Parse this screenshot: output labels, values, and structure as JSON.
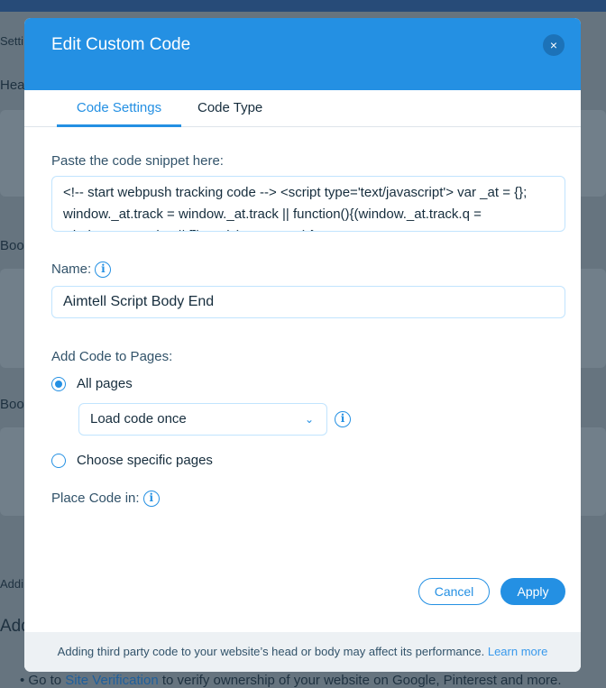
{
  "background": {
    "texts": [
      "Setti",
      "Hea",
      "Boo",
      "Boo",
      "Addi",
      "Add"
    ],
    "bullet_prefix": "Go to ",
    "bullet_link": "Site Verification",
    "bullet_suffix": " to verify ownership of your website on Google, Pinterest and more."
  },
  "modal": {
    "title": "Edit Custom Code",
    "close_icon": "×",
    "tabs": [
      {
        "label": "Code Settings",
        "active": true
      },
      {
        "label": "Code Type",
        "active": false
      }
    ],
    "code_label": "Paste the code snippet here:",
    "code_value": "<!-- start webpush tracking code --> <script type='text/javascript'> var _at = {}; window._at.track = window._at.track || function(){(window._at.track.q = window._at.track.q || []).push(arguments);};",
    "name_label": "Name:",
    "name_value": "Aimtell Script Body End",
    "pages_label": "Add Code to Pages:",
    "radio_all": "All pages",
    "load_select": "Load code once",
    "radio_specific": "Choose specific pages",
    "place_label": "Place Code in:",
    "info_icon": "i",
    "cancel": "Cancel",
    "apply": "Apply",
    "footer_text": "Adding third party code to your website’s head or body may affect its performance. ",
    "footer_link": "Learn more"
  },
  "colors": {
    "accent": "#2490e3",
    "footer_bg": "#edf1f4"
  }
}
